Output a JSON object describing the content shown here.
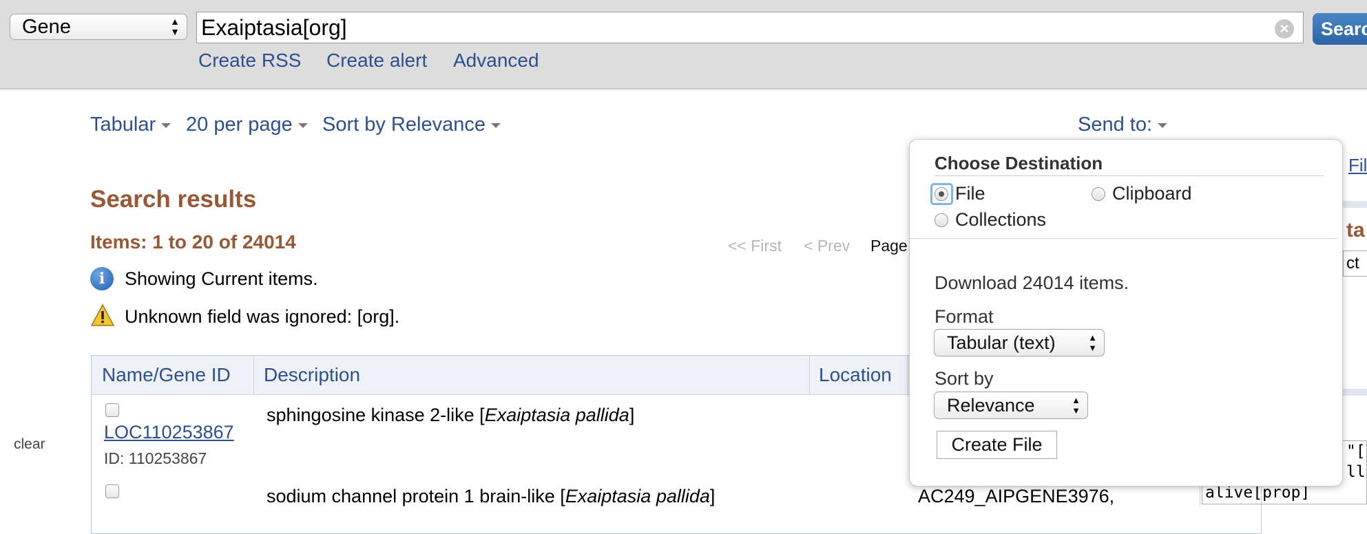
{
  "search_bar": {
    "database": "Gene",
    "query": "Exaiptasia[org]",
    "search_label": "Search",
    "links": [
      "Create RSS",
      "Create alert",
      "Advanced"
    ]
  },
  "display": {
    "format": "Tabular",
    "per_page": "20 per page",
    "sort": "Sort by Relevance",
    "send_to": "Send to:"
  },
  "results": {
    "heading": "Search results",
    "items": "Items: 1 to 20 of 24014",
    "pager": {
      "first": "<< First",
      "prev": "< Prev",
      "page": "Page"
    },
    "info_message": "Showing Current items.",
    "warning_message": "Unknown field was ignored: [org].",
    "columns": [
      "Name/Gene ID",
      "Description",
      "Location"
    ],
    "rows": [
      {
        "name": "LOC110253867",
        "id": "ID: 110253867",
        "description": "sphingosine kinase 2-like [",
        "organism": "Exaiptasia pallida",
        "close": "]",
        "location": ""
      },
      {
        "name": "",
        "id": "",
        "description": "sodium channel protein 1 brain-like [",
        "organism": "Exaiptasia pallida",
        "close": "]",
        "location": "AC249_AIPGENE3976,"
      }
    ]
  },
  "sidebar": {
    "clear": "clear"
  },
  "right_partial": {
    "file_link": "Fil",
    "heading_fragment": "ta",
    "input_fragment": "ct",
    "code1": "\"[",
    "code2": "ll",
    "code3": "alive[prop]"
  },
  "send_to_popup": {
    "title": "Choose Destination",
    "destinations": [
      {
        "label": "File",
        "selected": true
      },
      {
        "label": "Clipboard",
        "selected": false
      },
      {
        "label": "Collections",
        "selected": false
      }
    ],
    "download_text": "Download 24014 items.",
    "format_label": "Format",
    "format_value": "Tabular (text)",
    "sort_label": "Sort by",
    "sort_value": "Relevance",
    "button": "Create File"
  },
  "colors": {
    "link": "#2d4f8f",
    "heading": "#985735",
    "search_button": "#2b64a4"
  }
}
